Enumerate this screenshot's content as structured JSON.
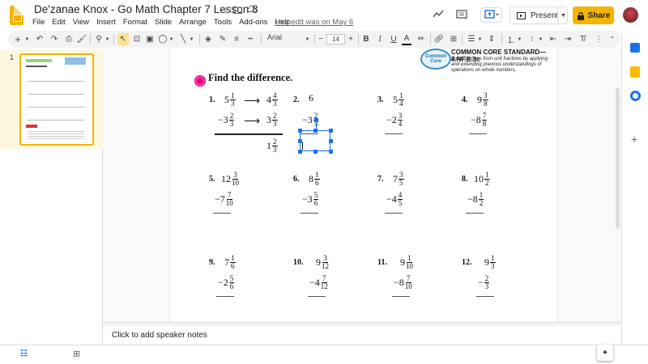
{
  "app": {
    "title": "De'zanae Knox - Go Math Chapter 7 Lesson 8",
    "last_edit": "Last edit was on May 6"
  },
  "menu": [
    "File",
    "Edit",
    "View",
    "Insert",
    "Format",
    "Slide",
    "Arrange",
    "Tools",
    "Add-ons",
    "Help"
  ],
  "header_buttons": {
    "present": "Present",
    "share": "Share"
  },
  "toolbar": {
    "font": "Arial",
    "font_size": "14",
    "minus": "−",
    "plus": "+"
  },
  "filmstrip": {
    "slide_number": "1"
  },
  "slide": {
    "heading": "Find the difference.",
    "cc_badge": "Common Core",
    "cc_standard": "COMMON CORE STANDARD—4.NF.B.3c",
    "cc_description": "Build fractions from unit fractions by applying and extending previous understandings of operations on whole numbers.",
    "problems": [
      {
        "num": "1.",
        "top_whole": "5",
        "top_n": "1",
        "top_d": "3",
        "conv_whole": "4",
        "conv_n": "4",
        "conv_d": "3",
        "bot_whole": "−3",
        "bot_n": "2",
        "bot_d": "3",
        "conv2_whole": "3",
        "conv2_n": "2",
        "conv2_d": "3",
        "ans_whole": "1",
        "ans_n": "2",
        "ans_d": "3"
      },
      {
        "num": "2.",
        "top_whole": "6",
        "bot_whole": "−3",
        "bot_n": "2",
        "bot_d": "5"
      },
      {
        "num": "3.",
        "top_whole": "5",
        "top_n": "1",
        "top_d": "4",
        "bot_whole": "−2",
        "bot_n": "3",
        "bot_d": "4"
      },
      {
        "num": "4.",
        "top_whole": "9",
        "top_n": "3",
        "top_d": "8",
        "bot_whole": "−8",
        "bot_n": "7",
        "bot_d": "8"
      },
      {
        "num": "5.",
        "top_whole": "12",
        "top_n": "3",
        "top_d": "10",
        "bot_whole": "−7",
        "bot_n": "7",
        "bot_d": "10"
      },
      {
        "num": "6.",
        "top_whole": "8",
        "top_n": "1",
        "top_d": "6",
        "bot_whole": "−3",
        "bot_n": "5",
        "bot_d": "6"
      },
      {
        "num": "7.",
        "top_whole": "7",
        "top_n": "3",
        "top_d": "5",
        "bot_whole": "−4",
        "bot_n": "4",
        "bot_d": "5"
      },
      {
        "num": "8.",
        "top_whole": "10",
        "top_n": "1",
        "top_d": "2",
        "bot_whole": "−8",
        "bot_n": "1",
        "bot_d": "2"
      },
      {
        "num": "9.",
        "top_whole": "7",
        "top_n": "1",
        "top_d": "6",
        "bot_whole": "−2",
        "bot_n": "5",
        "bot_d": "6"
      },
      {
        "num": "10.",
        "top_whole": "9",
        "top_n": "3",
        "top_d": "12",
        "bot_whole": "−4",
        "bot_n": "7",
        "bot_d": "12"
      },
      {
        "num": "11.",
        "top_whole": "9",
        "top_n": "1",
        "top_d": "10",
        "bot_whole": "−8",
        "bot_n": "7",
        "bot_d": "10"
      },
      {
        "num": "12.",
        "top_whole": "9",
        "top_n": "1",
        "top_d": "3",
        "bot_whole": "−",
        "bot_n": "2",
        "bot_d": "3"
      }
    ]
  },
  "notes": {
    "placeholder": "Click to add speaker notes"
  },
  "colors": {
    "accent": "#f4b400",
    "selection": "#1a73e8"
  }
}
